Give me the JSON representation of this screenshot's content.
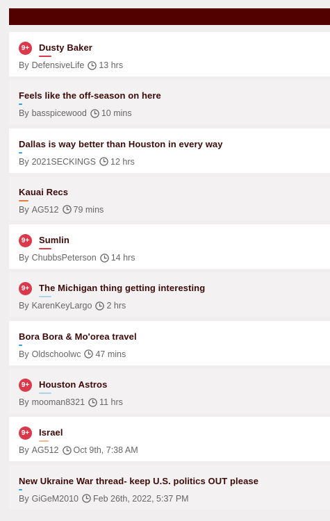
{
  "topics": [
    {
      "title": "Dusty Baker",
      "author": "DefensiveLife",
      "time": "13 hrs",
      "badge": "9+",
      "underline": "#d9394b",
      "underline_width": 18
    },
    {
      "title": "Feels like the off-season on here",
      "author": "basspicewood",
      "time": "10 mins",
      "badge": null,
      "underline": "#2a9fd6",
      "underline_width": 5
    },
    {
      "title": "Dallas is way better than Houston in every way",
      "author": "2021SECKINGS",
      "time": "12 hrs",
      "badge": null,
      "underline": "#2a9fd6",
      "underline_width": 5
    },
    {
      "title": "Kauai Recs",
      "author": "AG512",
      "time": "79 mins",
      "badge": null,
      "underline": "#e87a3c",
      "underline_width": 14
    },
    {
      "title": "Sumlin",
      "author": "ChubbsPeterson",
      "time": "14 hrs",
      "badge": "9+",
      "underline": "#d9394b",
      "underline_width": 18
    },
    {
      "title": "The Michigan thing getting interesting",
      "author": "KarenKeyLargo",
      "time": "2 hrs",
      "badge": "9+",
      "underline": "#a9d6ee",
      "underline_width": 18
    },
    {
      "title": "Bora Bora & Mo'orea travel",
      "author": "Oldschoolwc",
      "time": "47 mins",
      "badge": null,
      "underline": "#2a9fd6",
      "underline_width": 5
    },
    {
      "title": "Houston Astros",
      "author": "mooman8321",
      "time": "11 hrs",
      "badge": "9+",
      "underline": "#a9d6ee",
      "underline_width": 18
    },
    {
      "title": "Israel",
      "author": "AG512",
      "time": "Oct 9th, 7:38 AM",
      "badge": "9+",
      "underline": "#f4b58f",
      "underline_width": 14
    },
    {
      "title": "New Ukraine War thread- keep U.S. politics OUT please",
      "author": "GiGeM2010",
      "time": "Feb 26th, 2022, 5:37 PM",
      "badge": null,
      "underline": "#2a9fd6",
      "underline_width": 5
    }
  ],
  "by_label": "By",
  "clock_icon": "clock-icon"
}
